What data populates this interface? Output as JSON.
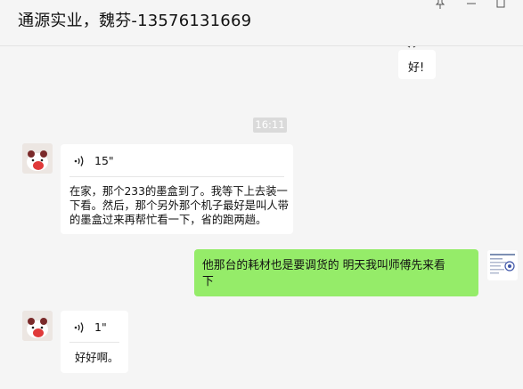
{
  "window": {
    "title": "通源实业，魏芬-13576131669",
    "pin_icon": "pin-icon",
    "minimize_icon": "minimize-icon",
    "maximize_icon": "maximize-icon"
  },
  "messages": {
    "partial": {
      "text": "好!"
    },
    "timestamp": "16:11",
    "voice1": {
      "duration": "15\"",
      "transcript_line1": "在家，那个233的墨盒到了。我等下上去装一",
      "transcript_line2": "下看。然后，那个另外那个机子最好是叫人带",
      "transcript_line3": "的墨盒过来再帮忙看一下，省的跑两趟。"
    },
    "outgoing1": {
      "line1": "他那台的耗材也是要调货的 明天我叫师傅先来看",
      "line2": "下"
    },
    "voice2": {
      "duration": "1\"",
      "transcript": "好好啊。"
    }
  },
  "colors": {
    "background": "#f5f5f5",
    "outgoing_bubble": "#95ec69",
    "incoming_bubble": "#ffffff",
    "timestamp_badge": "#dadada"
  }
}
